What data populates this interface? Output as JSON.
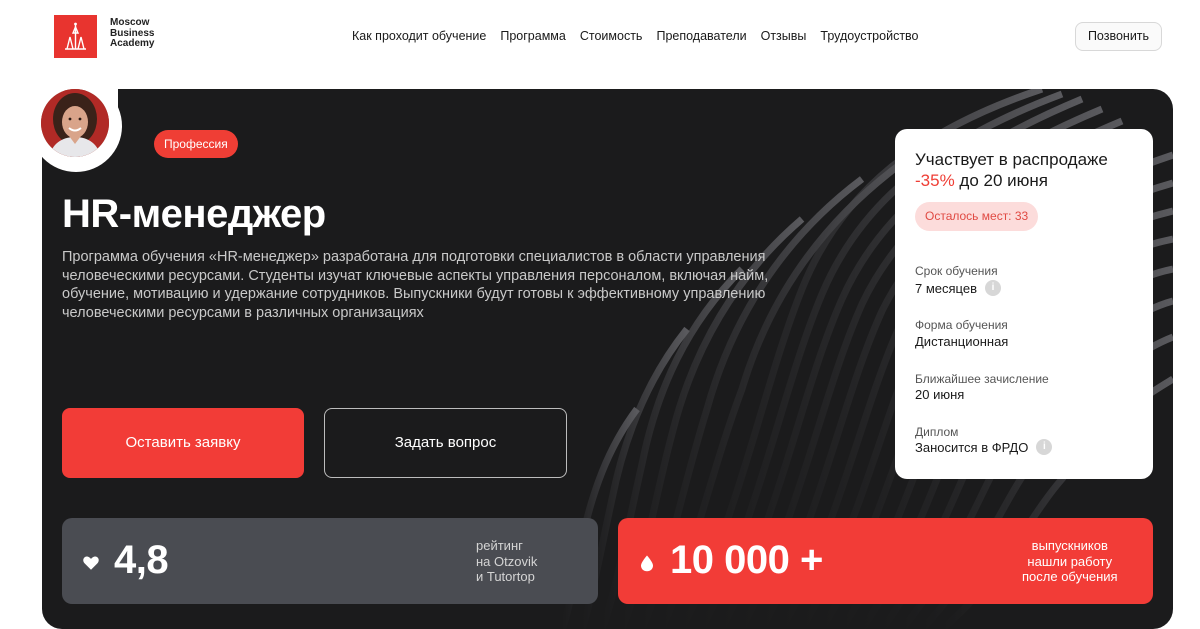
{
  "brand": {
    "logo_text": "Moscow\nBusiness\nAcademy",
    "color": "#e8342f"
  },
  "nav": {
    "items": [
      {
        "label": "Как проходит обучение"
      },
      {
        "label": "Программа"
      },
      {
        "label": "Стоимость"
      },
      {
        "label": "Преподаватели"
      },
      {
        "label": "Отзывы"
      },
      {
        "label": "Трудоустройство"
      }
    ],
    "call_label": "Позвонить"
  },
  "hero": {
    "badge": "Профессия",
    "title": "HR-менеджер",
    "description": "Программа обучения «HR-менеджер» разработана для подготовки специалистов в области управления человеческими ресурсами. Студенты изучат ключевые аспекты управления персоналом, включая найм, обучение, мотивацию и удержание сотрудников. Выпускники будут готовы к эффективному управлению человеческими ресурсами в различных организациях",
    "primary_button": "Оставить заявку",
    "secondary_button": "Задать вопрос",
    "background_color": "#1b1b1c",
    "accent_color": "#f23c37"
  },
  "stats": {
    "rating": {
      "icon": "heart-icon",
      "value": "4,8",
      "caption": "рейтинг\nна Otzovik\nи Tutortop"
    },
    "graduates": {
      "icon": "drop-icon",
      "value": "10 000 +",
      "caption": "выпускников\nнашли работу\nпосле обучения"
    }
  },
  "card": {
    "heading_prefix": "Участвует в распродаже",
    "discount": "-35%",
    "heading_suffix": " до 20 июня",
    "seats": "Осталось мест: 33",
    "rows": [
      {
        "label": "Срок обучения",
        "value": "7 месяцев",
        "info": true
      },
      {
        "label": "Форма обучения",
        "value": "Дистанционная",
        "info": false
      },
      {
        "label": "Ближайшее зачисление",
        "value": "20 июня",
        "info": false
      },
      {
        "label": "Диплом",
        "value": "Заносится в ФРДО",
        "info": true
      }
    ]
  }
}
